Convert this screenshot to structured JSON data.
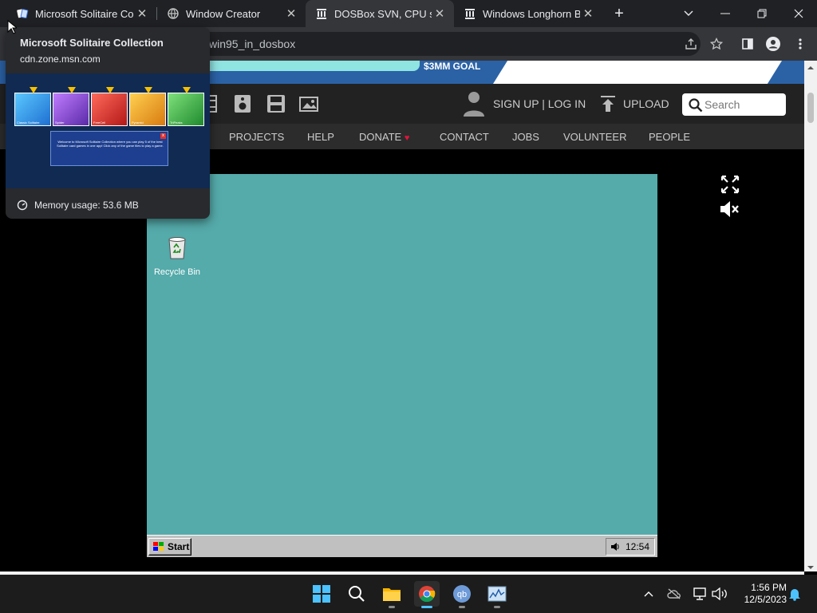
{
  "browser": {
    "tabs": [
      {
        "title": "Microsoft Solitaire Col",
        "active": false
      },
      {
        "title": "Window Creator",
        "active": false
      },
      {
        "title": "DOSBox SVN, CPU spe",
        "active": true
      },
      {
        "title": "Windows Longhorn Bu",
        "active": false
      }
    ],
    "new_tab": "+",
    "address": "win95_in_dosbox"
  },
  "hover_card": {
    "title": "Microsoft Solitaire Collection",
    "url": "cdn.zone.msn.com",
    "memory": "Memory usage: 53.6 MB",
    "tiles": [
      "Classic Solitaire",
      "Spider",
      "FreeCell",
      "Pyramid",
      "TriPeaks"
    ],
    "welcome_text": "Welcome to Microsoft Solitaire Collection where you can play 5 of the best Solitaire card games in one app! Click any of the game tiles to play a game.",
    "welcome_close": "x"
  },
  "archive": {
    "banner_goal": "$3MM GOAL",
    "signup": "SIGN UP | LOG IN",
    "upload": "UPLOAD",
    "search_placeholder": "Search",
    "menu": [
      "PROJECTS",
      "HELP",
      "DONATE",
      "CONTACT",
      "JOBS",
      "VOLUNTEER",
      "PEOPLE"
    ],
    "donate_heart": "♥"
  },
  "win95": {
    "desktop_color": "#55aaaa",
    "recycle_bin": "Recycle Bin",
    "start": "Start",
    "clock": "12:54"
  },
  "win11": {
    "time": "1:56 PM",
    "date": "12/5/2023",
    "accent": "#4cc2ff"
  }
}
